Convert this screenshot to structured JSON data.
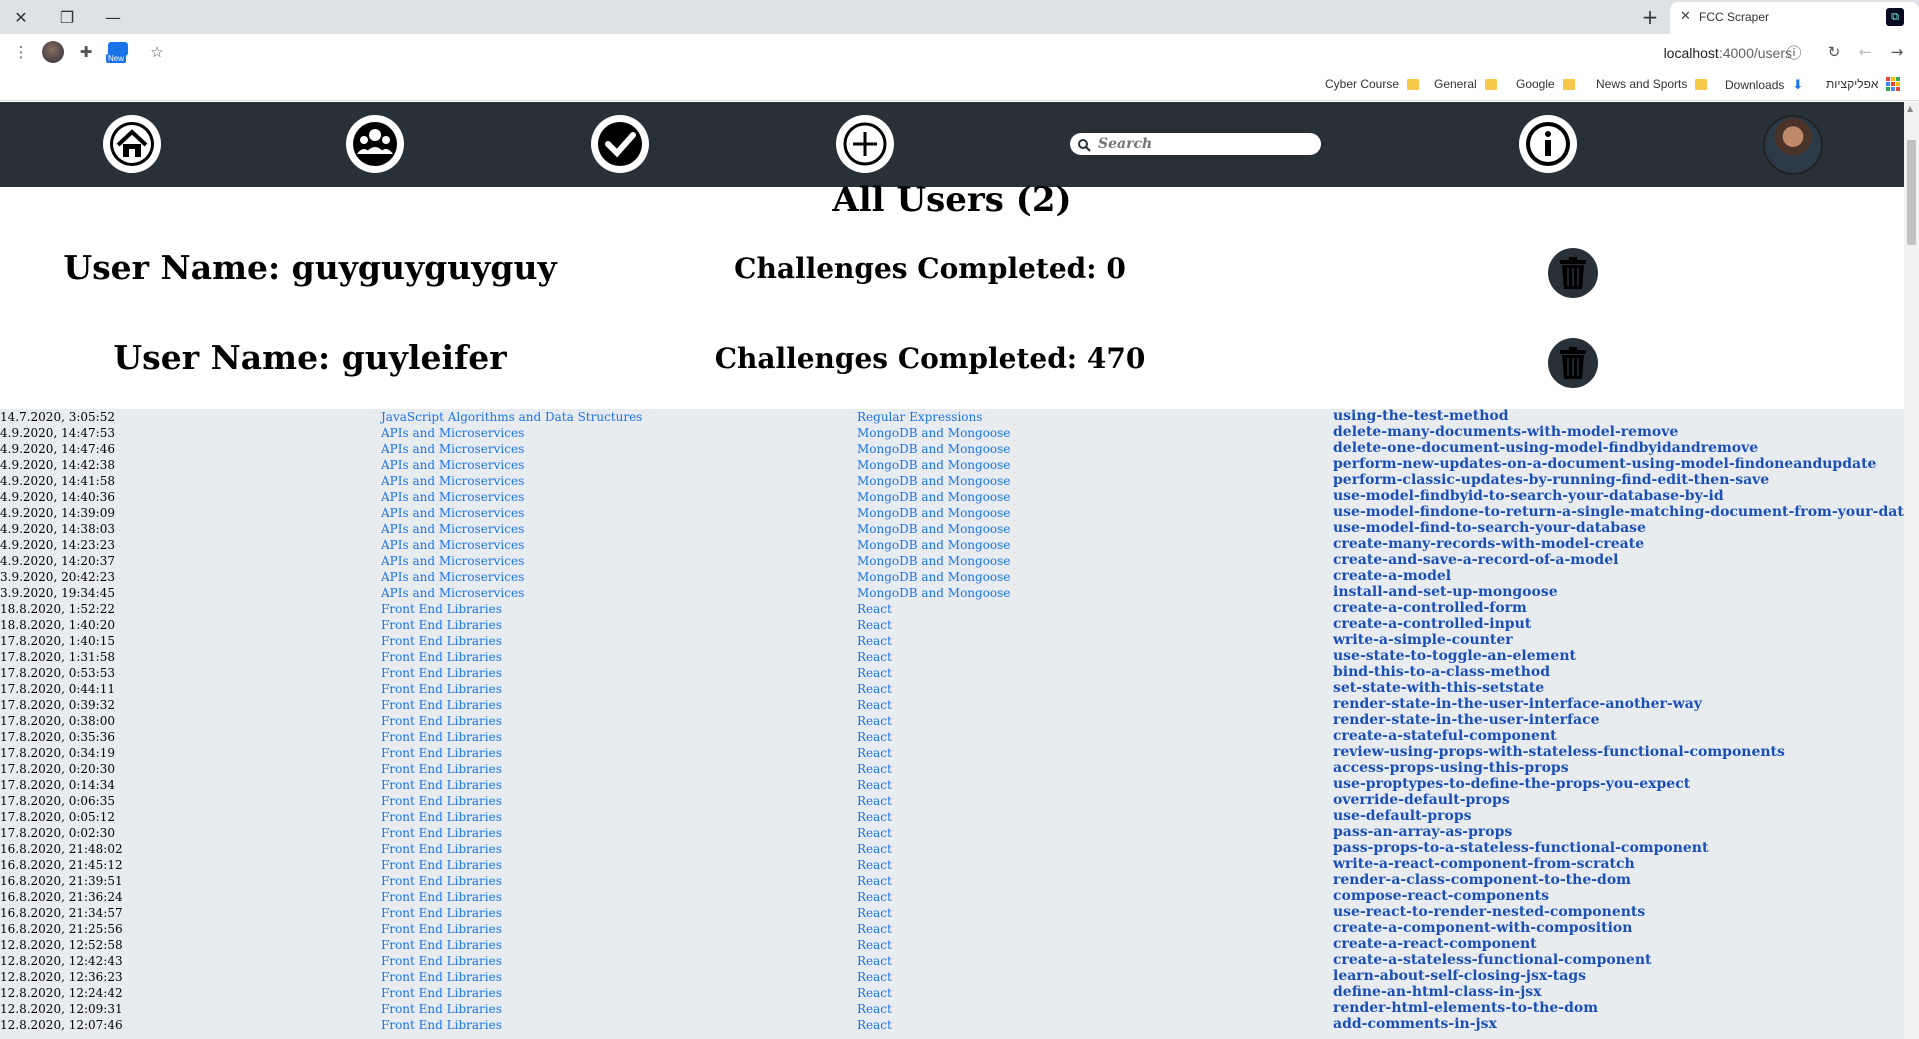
{
  "browser": {
    "tab_title": "FCC Scraper",
    "url_host": "localhost",
    "url_path": ":4000/users",
    "new_badge": "New",
    "bookmarks": [
      {
        "label": "Cyber Course",
        "type": "folder"
      },
      {
        "label": "General",
        "type": "folder"
      },
      {
        "label": "Google",
        "type": "folder"
      },
      {
        "label": "News and Sports",
        "type": "folder"
      },
      {
        "label": "Downloads",
        "type": "download"
      },
      {
        "label": "אפליקציות",
        "type": "apps"
      }
    ]
  },
  "nav": {
    "icons": [
      "home-icon",
      "users-icon",
      "check-icon",
      "add-icon",
      "info-icon"
    ],
    "search_placeholder": "Search"
  },
  "page": {
    "title": "All Users (2)",
    "users": [
      {
        "name_label": "User Name: guyguyguyguy",
        "count_label": "Challenges Completed: 0"
      },
      {
        "name_label": "User Name: guyleifer",
        "count_label": "Challenges Completed: 470"
      }
    ]
  },
  "colors": {
    "navbar": "#283038",
    "link": "#1a73e8",
    "table_bg": "#e9ecef"
  },
  "challenges": [
    {
      "date": "14.7.2020, 3:05:52",
      "cert": "JavaScript Algorithms and Data Structures",
      "block": "Regular Expressions",
      "slug": "using-the-test-method"
    },
    {
      "date": "4.9.2020, 14:47:53",
      "cert": "APIs and Microservices",
      "block": "MongoDB and Mongoose",
      "slug": "delete-many-documents-with-model-remove"
    },
    {
      "date": "4.9.2020, 14:47:46",
      "cert": "APIs and Microservices",
      "block": "MongoDB and Mongoose",
      "slug": "delete-one-document-using-model-findbyidandremove"
    },
    {
      "date": "4.9.2020, 14:42:38",
      "cert": "APIs and Microservices",
      "block": "MongoDB and Mongoose",
      "slug": "perform-new-updates-on-a-document-using-model-findoneandupdate"
    },
    {
      "date": "4.9.2020, 14:41:58",
      "cert": "APIs and Microservices",
      "block": "MongoDB and Mongoose",
      "slug": "perform-classic-updates-by-running-find-edit-then-save"
    },
    {
      "date": "4.9.2020, 14:40:36",
      "cert": "APIs and Microservices",
      "block": "MongoDB and Mongoose",
      "slug": "use-model-findbyid-to-search-your-database-by-id"
    },
    {
      "date": "4.9.2020, 14:39:09",
      "cert": "APIs and Microservices",
      "block": "MongoDB and Mongoose",
      "slug": "use-model-findone-to-return-a-single-matching-document-from-your-database"
    },
    {
      "date": "4.9.2020, 14:38:03",
      "cert": "APIs and Microservices",
      "block": "MongoDB and Mongoose",
      "slug": "use-model-find-to-search-your-database"
    },
    {
      "date": "4.9.2020, 14:23:23",
      "cert": "APIs and Microservices",
      "block": "MongoDB and Mongoose",
      "slug": "create-many-records-with-model-create"
    },
    {
      "date": "4.9.2020, 14:20:37",
      "cert": "APIs and Microservices",
      "block": "MongoDB and Mongoose",
      "slug": "create-and-save-a-record-of-a-model"
    },
    {
      "date": "3.9.2020, 20:42:23",
      "cert": "APIs and Microservices",
      "block": "MongoDB and Mongoose",
      "slug": "create-a-model"
    },
    {
      "date": "3.9.2020, 19:34:45",
      "cert": "APIs and Microservices",
      "block": "MongoDB and Mongoose",
      "slug": "install-and-set-up-mongoose"
    },
    {
      "date": "18.8.2020, 1:52:22",
      "cert": "Front End Libraries",
      "block": "React",
      "slug": "create-a-controlled-form"
    },
    {
      "date": "18.8.2020, 1:40:20",
      "cert": "Front End Libraries",
      "block": "React",
      "slug": "create-a-controlled-input"
    },
    {
      "date": "17.8.2020, 1:40:15",
      "cert": "Front End Libraries",
      "block": "React",
      "slug": "write-a-simple-counter"
    },
    {
      "date": "17.8.2020, 1:31:58",
      "cert": "Front End Libraries",
      "block": "React",
      "slug": "use-state-to-toggle-an-element"
    },
    {
      "date": "17.8.2020, 0:53:53",
      "cert": "Front End Libraries",
      "block": "React",
      "slug": "bind-this-to-a-class-method"
    },
    {
      "date": "17.8.2020, 0:44:11",
      "cert": "Front End Libraries",
      "block": "React",
      "slug": "set-state-with-this-setstate"
    },
    {
      "date": "17.8.2020, 0:39:32",
      "cert": "Front End Libraries",
      "block": "React",
      "slug": "render-state-in-the-user-interface-another-way"
    },
    {
      "date": "17.8.2020, 0:38:00",
      "cert": "Front End Libraries",
      "block": "React",
      "slug": "render-state-in-the-user-interface"
    },
    {
      "date": "17.8.2020, 0:35:36",
      "cert": "Front End Libraries",
      "block": "React",
      "slug": "create-a-stateful-component"
    },
    {
      "date": "17.8.2020, 0:34:19",
      "cert": "Front End Libraries",
      "block": "React",
      "slug": "review-using-props-with-stateless-functional-components"
    },
    {
      "date": "17.8.2020, 0:20:30",
      "cert": "Front End Libraries",
      "block": "React",
      "slug": "access-props-using-this-props"
    },
    {
      "date": "17.8.2020, 0:14:34",
      "cert": "Front End Libraries",
      "block": "React",
      "slug": "use-proptypes-to-define-the-props-you-expect"
    },
    {
      "date": "17.8.2020, 0:06:35",
      "cert": "Front End Libraries",
      "block": "React",
      "slug": "override-default-props"
    },
    {
      "date": "17.8.2020, 0:05:12",
      "cert": "Front End Libraries",
      "block": "React",
      "slug": "use-default-props"
    },
    {
      "date": "17.8.2020, 0:02:30",
      "cert": "Front End Libraries",
      "block": "React",
      "slug": "pass-an-array-as-props"
    },
    {
      "date": "16.8.2020, 21:48:02",
      "cert": "Front End Libraries",
      "block": "React",
      "slug": "pass-props-to-a-stateless-functional-component"
    },
    {
      "date": "16.8.2020, 21:45:12",
      "cert": "Front End Libraries",
      "block": "React",
      "slug": "write-a-react-component-from-scratch"
    },
    {
      "date": "16.8.2020, 21:39:51",
      "cert": "Front End Libraries",
      "block": "React",
      "slug": "render-a-class-component-to-the-dom"
    },
    {
      "date": "16.8.2020, 21:36:24",
      "cert": "Front End Libraries",
      "block": "React",
      "slug": "compose-react-components"
    },
    {
      "date": "16.8.2020, 21:34:57",
      "cert": "Front End Libraries",
      "block": "React",
      "slug": "use-react-to-render-nested-components"
    },
    {
      "date": "16.8.2020, 21:25:56",
      "cert": "Front End Libraries",
      "block": "React",
      "slug": "create-a-component-with-composition"
    },
    {
      "date": "12.8.2020, 12:52:58",
      "cert": "Front End Libraries",
      "block": "React",
      "slug": "create-a-react-component"
    },
    {
      "date": "12.8.2020, 12:42:43",
      "cert": "Front End Libraries",
      "block": "React",
      "slug": "create-a-stateless-functional-component"
    },
    {
      "date": "12.8.2020, 12:36:23",
      "cert": "Front End Libraries",
      "block": "React",
      "slug": "learn-about-self-closing-jsx-tags"
    },
    {
      "date": "12.8.2020, 12:24:42",
      "cert": "Front End Libraries",
      "block": "React",
      "slug": "define-an-html-class-in-jsx"
    },
    {
      "date": "12.8.2020, 12:09:31",
      "cert": "Front End Libraries",
      "block": "React",
      "slug": "render-html-elements-to-the-dom"
    },
    {
      "date": "12.8.2020, 12:07:46",
      "cert": "Front End Libraries",
      "block": "React",
      "slug": "add-comments-in-jsx"
    }
  ]
}
